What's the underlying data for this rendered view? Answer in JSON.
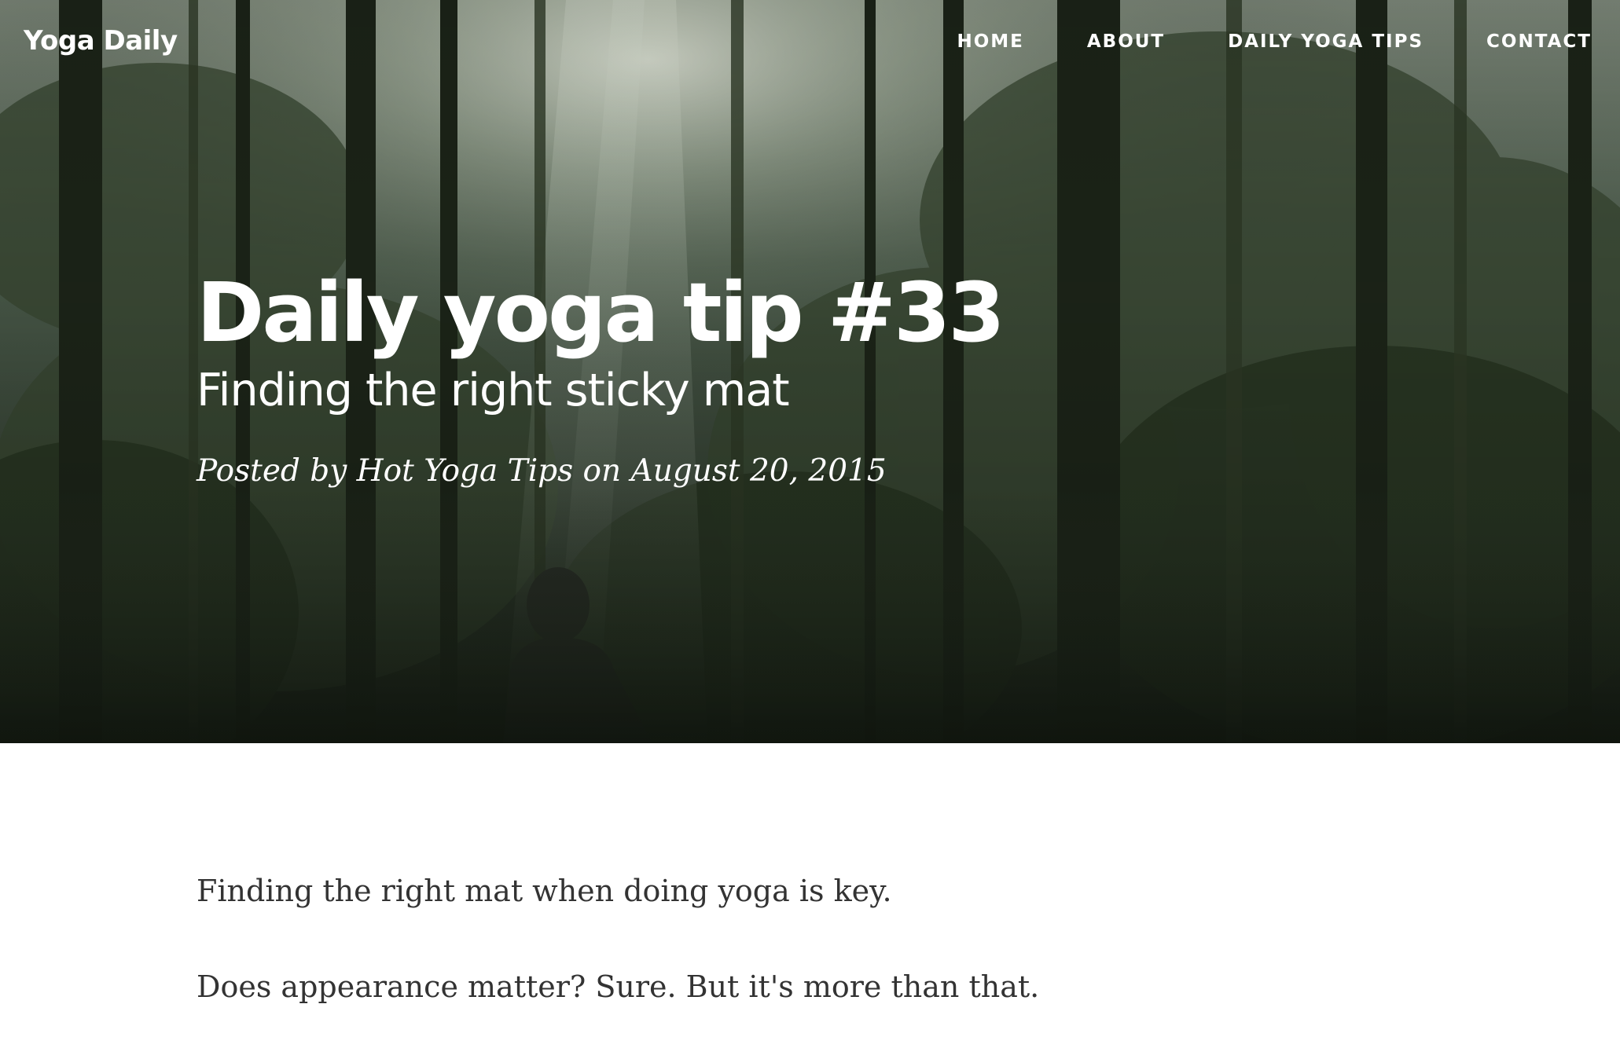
{
  "navbar": {
    "brand": "Yoga Daily",
    "links": [
      {
        "label": "Home"
      },
      {
        "label": "About"
      },
      {
        "label": "Daily Yoga Tips"
      },
      {
        "label": "Contact"
      }
    ]
  },
  "post": {
    "title": "Daily yoga tip #33",
    "subtitle": "Finding the right sticky mat",
    "meta": "Posted by Hot Yoga Tips on August 20, 2015"
  },
  "article": {
    "paragraphs": [
      "Finding the right mat when doing yoga is key.",
      "Does appearance matter? Sure. But it's more than that."
    ]
  },
  "colors": {
    "hero_base": "#1f2a22",
    "nav_text": "#ffffff",
    "body_text": "#333333",
    "background": "#ffffff"
  },
  "hero_image": {
    "subject": "forest-person-hooded-photo"
  }
}
